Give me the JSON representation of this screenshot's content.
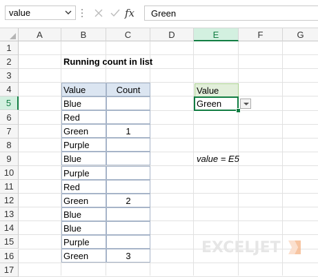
{
  "formula_bar": {
    "name_box": "value",
    "fx_label": "fx",
    "content": "Green"
  },
  "columns": [
    "A",
    "B",
    "C",
    "D",
    "E",
    "F",
    "G"
  ],
  "active_column": "E",
  "rows": [
    "1",
    "2",
    "3",
    "4",
    "5",
    "6",
    "7",
    "8",
    "9",
    "10",
    "11",
    "12",
    "13",
    "14",
    "15",
    "16",
    "17"
  ],
  "active_row": "5",
  "sheet": {
    "title": "Running count in list",
    "table": {
      "headers": [
        "Value",
        "Count"
      ],
      "rows": [
        {
          "value": "Blue",
          "count": ""
        },
        {
          "value": "Red",
          "count": ""
        },
        {
          "value": "Green",
          "count": "1"
        },
        {
          "value": "Purple",
          "count": ""
        },
        {
          "value": "Blue",
          "count": ""
        },
        {
          "value": "Purple",
          "count": ""
        },
        {
          "value": "Red",
          "count": ""
        },
        {
          "value": "Green",
          "count": "2"
        },
        {
          "value": "Blue",
          "count": ""
        },
        {
          "value": "Blue",
          "count": ""
        },
        {
          "value": "Purple",
          "count": ""
        },
        {
          "value": "Green",
          "count": "3"
        }
      ]
    },
    "input_header": "Value",
    "input_value": "Green",
    "note": "value = E5"
  },
  "logo": {
    "text": "EXCELJET"
  },
  "colors": {
    "accent": "#107c41",
    "table_header": "#dbe5f1",
    "input_header": "#e2efda",
    "logo_mark": "#f4b183"
  }
}
